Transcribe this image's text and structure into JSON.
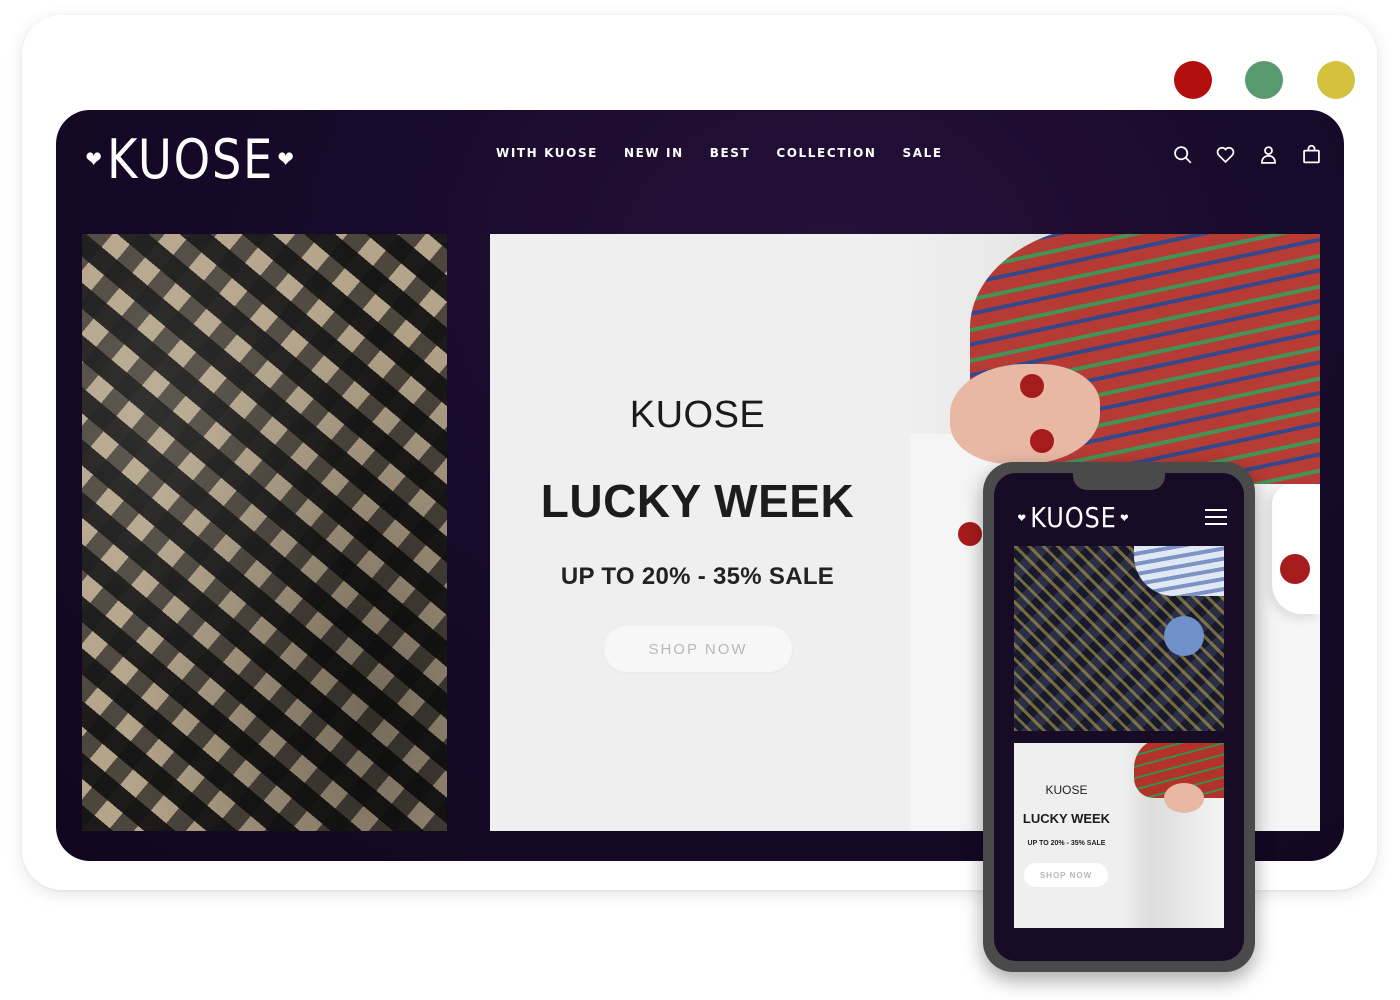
{
  "colors": {
    "dot_red": "#b20e0e",
    "dot_green": "#589a6e",
    "dot_yellow": "#d4c23e",
    "header_bg": "#170a2a"
  },
  "brand": {
    "logo_text": "KUOSE",
    "heart_glyph": "❤"
  },
  "nav": {
    "items": [
      "WITH KUOSE",
      "NEW IN",
      "BEST",
      "COLLECTION",
      "SALE"
    ]
  },
  "header_icons": [
    "search-icon",
    "heart-icon",
    "user-icon",
    "bag-icon"
  ],
  "banner": {
    "brand": "KUOSE",
    "title": "LUCKY WEEK",
    "subtitle": "UP TO 20% - 35% SALE",
    "cta": "SHOP NOW"
  },
  "mobile": {
    "logo_text": "KUOSE",
    "brand": "KUOSE",
    "title": "LUCKY WEEK",
    "subtitle": "UP TO 20% - 35% SALE",
    "cta": "SHOP NOW"
  }
}
